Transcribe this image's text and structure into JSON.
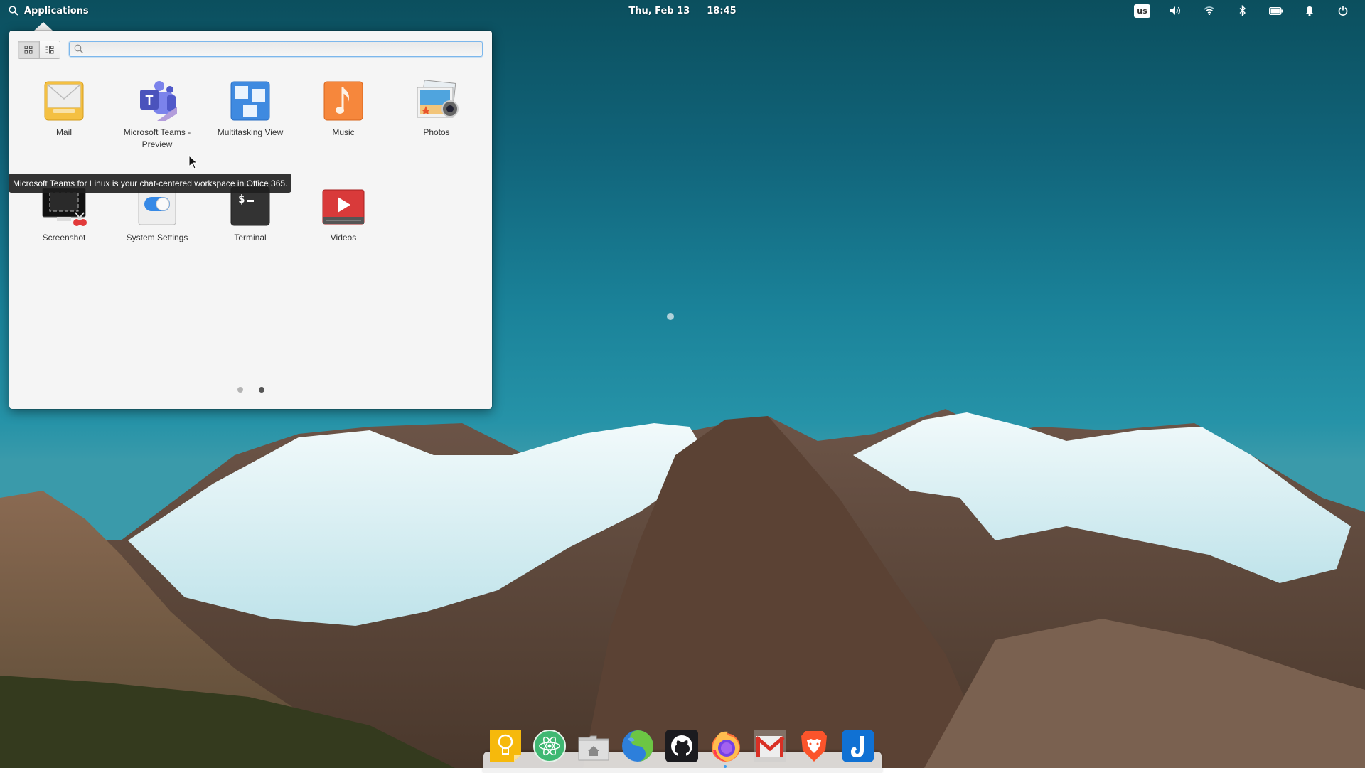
{
  "panel": {
    "applications_label": "Applications",
    "date": "Thu, Feb 13",
    "time": "18:45",
    "keyboard_layout": "us",
    "indicators": [
      "sound-icon",
      "network-wifi-icon",
      "bluetooth-icon",
      "battery-icon",
      "notifications-icon",
      "power-icon"
    ]
  },
  "launcher": {
    "search_placeholder": "",
    "search_value": "",
    "view_modes": [
      "grid",
      "category"
    ],
    "active_view": "grid",
    "apps": [
      {
        "label": "Mail",
        "icon": "mail-icon"
      },
      {
        "label": "Microsoft Teams - Preview",
        "icon": "teams-icon"
      },
      {
        "label": "Multitasking View",
        "icon": "multitasking-view-icon"
      },
      {
        "label": "Music",
        "icon": "music-icon"
      },
      {
        "label": "Photos",
        "icon": "photos-icon"
      },
      {
        "label": "Screenshot",
        "icon": "screenshot-icon"
      },
      {
        "label": "System Settings",
        "icon": "system-settings-icon"
      },
      {
        "label": "Terminal",
        "icon": "terminal-icon"
      },
      {
        "label": "Videos",
        "icon": "videos-icon"
      }
    ],
    "pages": 2,
    "current_page": 2,
    "tooltip": "Microsoft Teams for Linux is your chat-centered workspace in Office 365."
  },
  "dock": {
    "items": [
      {
        "name": "Keep Notes",
        "icon": "lightbulb-notes-icon"
      },
      {
        "name": "Atom",
        "icon": "atom-icon"
      },
      {
        "name": "Files",
        "icon": "home-folder-icon"
      },
      {
        "name": "Web Browser",
        "icon": "globe-browser-icon"
      },
      {
        "name": "GitHub",
        "icon": "github-icon"
      },
      {
        "name": "Firefox",
        "icon": "firefox-icon",
        "running": true
      },
      {
        "name": "Gmail",
        "icon": "gmail-icon"
      },
      {
        "name": "Brave",
        "icon": "brave-icon"
      },
      {
        "name": "Joplin",
        "icon": "joplin-icon"
      }
    ]
  },
  "colors": {
    "panel_text": "#ffffff",
    "accent": "#3689e6",
    "popover_bg": "#f5f5f5",
    "search_focus": "#7cb7ec",
    "dot_inactive": "#b4b4b4",
    "dot_active": "#555555"
  }
}
